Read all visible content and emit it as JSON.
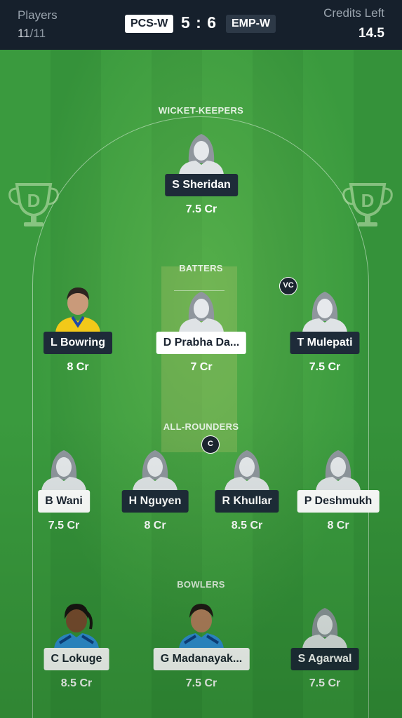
{
  "header": {
    "players_label": "Players",
    "players_selected": "11",
    "players_max": "/11",
    "team_left": "PCS-W",
    "score": "5 : 6",
    "team_right": "EMP-W",
    "credits_label": "Credits Left",
    "credits_value": "14.5"
  },
  "sections": {
    "wicket_keepers": "WICKET-KEEPERS",
    "batters": "BATTERS",
    "all_rounders": "ALL-ROUNDERS",
    "bowlers": "BOWLERS"
  },
  "players": {
    "wk1": {
      "name": "S Sheridan",
      "credit": "7.5 Cr",
      "team": "EMP-W"
    },
    "bat1": {
      "name": "L Bowring",
      "credit": "8 Cr",
      "team": "EMP-W"
    },
    "bat2": {
      "name": "D Prabha Da...",
      "credit": "7 Cr",
      "team": "PCS-W"
    },
    "bat3": {
      "name": "T Mulepati",
      "credit": "7.5 Cr",
      "team": "EMP-W",
      "role": "VC"
    },
    "ar1": {
      "name": "B Wani",
      "credit": "7.5 Cr",
      "team": "PCS-W"
    },
    "ar2": {
      "name": "H Nguyen",
      "credit": "8 Cr",
      "team": "EMP-W"
    },
    "ar3": {
      "name": "R Khullar",
      "credit": "8.5 Cr",
      "team": "EMP-W",
      "role": "C"
    },
    "ar4": {
      "name": "P Deshmukh",
      "credit": "8 Cr",
      "team": "PCS-W"
    },
    "bowl1": {
      "name": "C Lokuge",
      "credit": "8.5 Cr",
      "team": "PCS-W"
    },
    "bowl2": {
      "name": "G Madanayak...",
      "credit": "7.5 Cr",
      "team": "PCS-W"
    },
    "bowl3": {
      "name": "S Agarwal",
      "credit": "7.5 Cr",
      "team": "EMP-W"
    }
  },
  "icons": {
    "watermark": "trophy-d-logo-icon",
    "placeholder_avatar": "player-silhouette-icon"
  },
  "colors": {
    "header_bg": "#16202c",
    "field_green": "#3a9a3e",
    "light_team_tag": "#ffffff",
    "dark_team_tag": "#1e2b39"
  }
}
